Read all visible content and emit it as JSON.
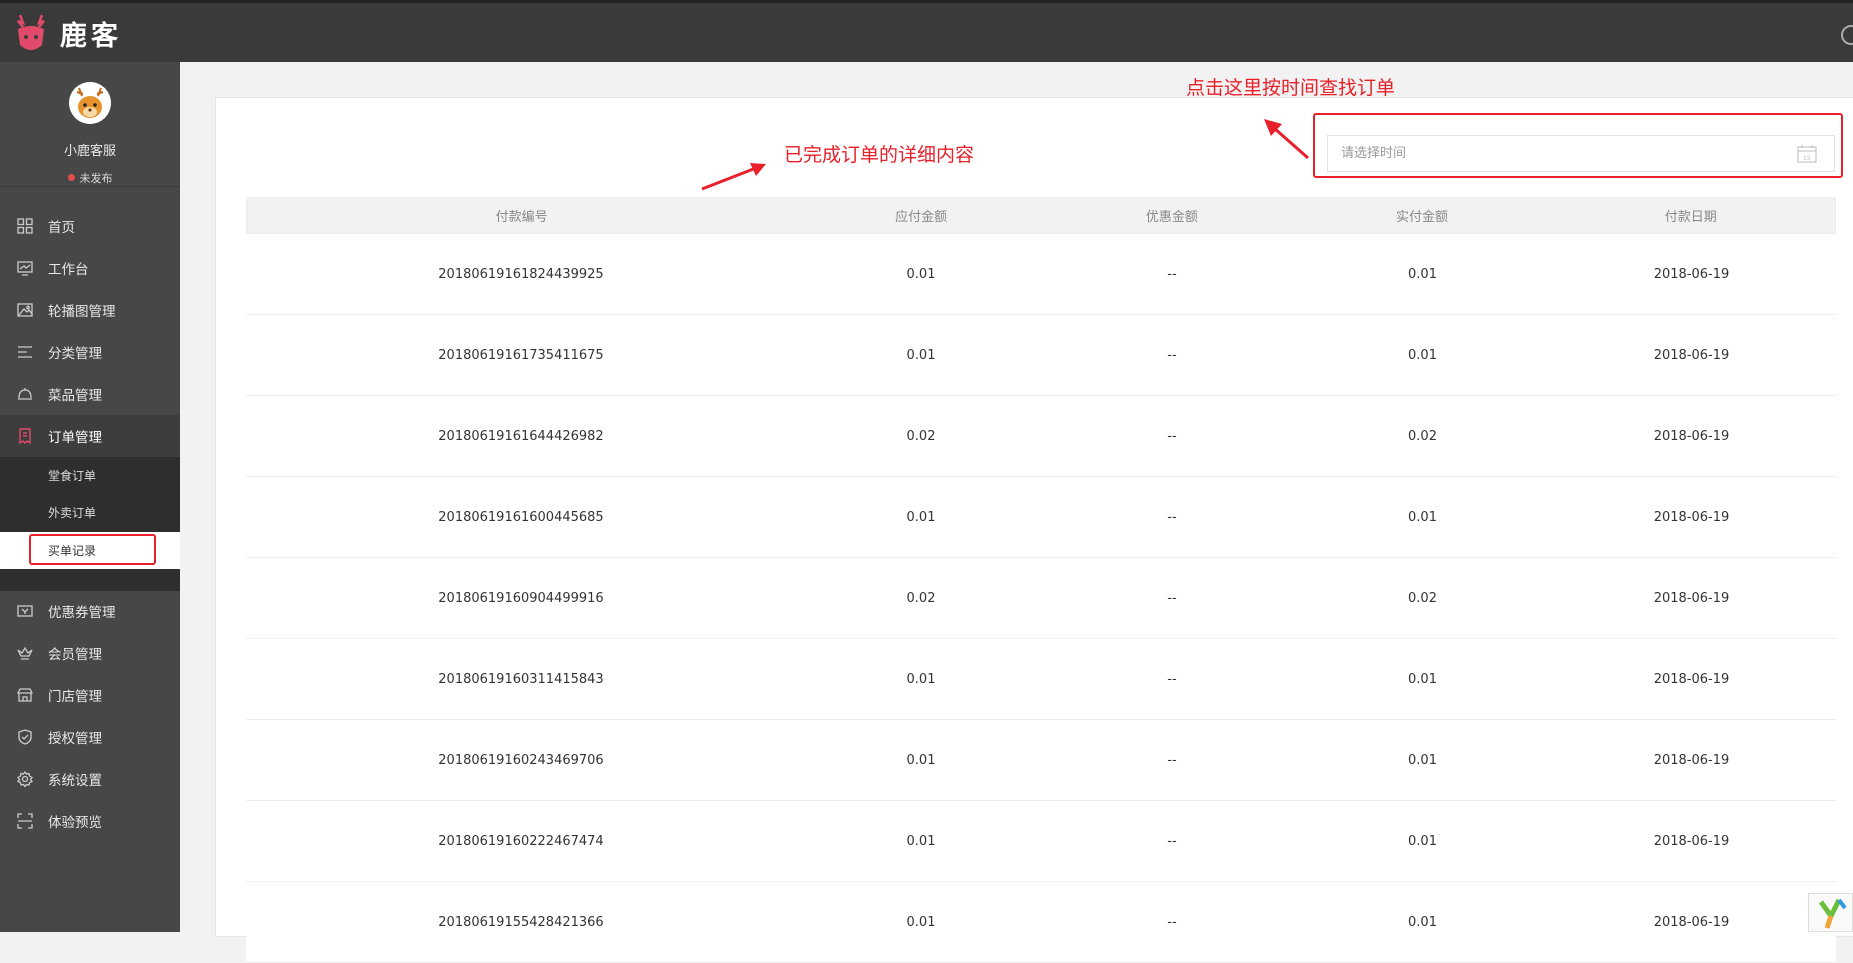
{
  "app": {
    "brand": "鹿客"
  },
  "profile": {
    "name": "小鹿客服",
    "status": "未发布"
  },
  "sidebar": {
    "items": [
      {
        "label": "首页",
        "icon": "grid-icon"
      },
      {
        "label": "工作台",
        "icon": "monitor-icon"
      },
      {
        "label": "轮播图管理",
        "icon": "image-icon"
      },
      {
        "label": "分类管理",
        "icon": "list-icon"
      },
      {
        "label": "菜品管理",
        "icon": "dish-icon"
      },
      {
        "label": "订单管理",
        "icon": "order-icon"
      },
      {
        "label": "优惠券管理",
        "icon": "coupon-icon"
      },
      {
        "label": "会员管理",
        "icon": "crown-icon"
      },
      {
        "label": "门店管理",
        "icon": "store-icon"
      },
      {
        "label": "授权管理",
        "icon": "shield-icon"
      },
      {
        "label": "系统设置",
        "icon": "gear-icon"
      },
      {
        "label": "体验预览",
        "icon": "scan-icon"
      }
    ],
    "sub_items": [
      "堂食订单",
      "外卖订单",
      "买单记录"
    ]
  },
  "annotations": {
    "table_note": "已完成订单的详细内容",
    "date_note": "点击这里按时间查找订单"
  },
  "filter": {
    "date_placeholder": "请选择时间"
  },
  "table": {
    "headers": [
      "付款编号",
      "应付金额",
      "优惠金额",
      "实付金额",
      "付款日期"
    ],
    "rows": [
      [
        "20180619161824439925",
        "0.01",
        "--",
        "0.01",
        "2018-06-19"
      ],
      [
        "20180619161735411675",
        "0.01",
        "--",
        "0.01",
        "2018-06-19"
      ],
      [
        "20180619161644426982",
        "0.02",
        "--",
        "0.02",
        "2018-06-19"
      ],
      [
        "20180619161600445685",
        "0.01",
        "--",
        "0.01",
        "2018-06-19"
      ],
      [
        "20180619160904499916",
        "0.02",
        "--",
        "0.02",
        "2018-06-19"
      ],
      [
        "20180619160311415843",
        "0.01",
        "--",
        "0.01",
        "2018-06-19"
      ],
      [
        "20180619160243469706",
        "0.01",
        "--",
        "0.01",
        "2018-06-19"
      ],
      [
        "20180619160222467474",
        "0.01",
        "--",
        "0.01",
        "2018-06-19"
      ],
      [
        "20180619155428421366",
        "0.01",
        "--",
        "0.01",
        "2018-06-19"
      ]
    ]
  },
  "colors": {
    "accent_red": "#e8202a",
    "sidebar_bg": "#474747",
    "topbar_bg": "#3a3a3a"
  }
}
